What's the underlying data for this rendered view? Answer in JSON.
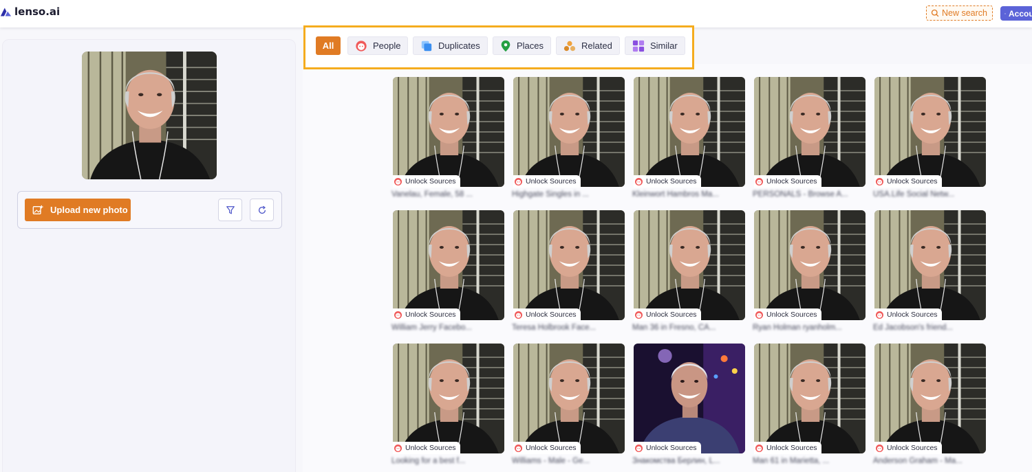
{
  "app": {
    "logo_text": "lenso.ai",
    "accent": "#e07b24",
    "brand": "#5b63d8"
  },
  "header": {
    "new_search_label": "New search",
    "account_label": "Account"
  },
  "upload": {
    "button_label": "Upload new photo",
    "filter_icon": "filter-icon",
    "refresh_icon": "refresh-icon"
  },
  "tabs": [
    {
      "label": "All",
      "icon": "",
      "active": true
    },
    {
      "label": "People",
      "icon": "people-face-icon"
    },
    {
      "label": "Duplicates",
      "icon": "duplicates-icon"
    },
    {
      "label": "Places",
      "icon": "map-pin-icon"
    },
    {
      "label": "Related",
      "icon": "related-cluster-icon"
    },
    {
      "label": "Similar",
      "icon": "similar-grid-icon"
    }
  ],
  "results": {
    "unlock_label": "Unlock Sources",
    "items": [
      {
        "caption": "Vanelau, Female, 58 ...",
        "variant": "office"
      },
      {
        "caption": "Highgate Singles in ...",
        "variant": "office"
      },
      {
        "caption": "Kleinwort Hambros Ma...",
        "variant": "office"
      },
      {
        "caption": "PERSONALS - Browse A...",
        "variant": "office"
      },
      {
        "caption": "USA.Life Social Netw...",
        "variant": "office"
      },
      {
        "caption": "William Jerry Facebo...",
        "variant": "office"
      },
      {
        "caption": "Teresa Holbrook Face...",
        "variant": "office"
      },
      {
        "caption": "Man 36 in Fresno, CA...",
        "variant": "office"
      },
      {
        "caption": "Ryan Holman ryanholm...",
        "variant": "office"
      },
      {
        "caption": "Ed Jacobson's friend...",
        "variant": "office"
      },
      {
        "caption": "Looking for a best f...",
        "variant": "office"
      },
      {
        "caption": "Williams - Male - Ge...",
        "variant": "office"
      },
      {
        "caption": "Знакомства Берлин, L...",
        "variant": "night"
      },
      {
        "caption": "Man 61 in Marietta, ...",
        "variant": "office"
      },
      {
        "caption": "Anderson Graham - Ma...",
        "variant": "office"
      }
    ]
  }
}
